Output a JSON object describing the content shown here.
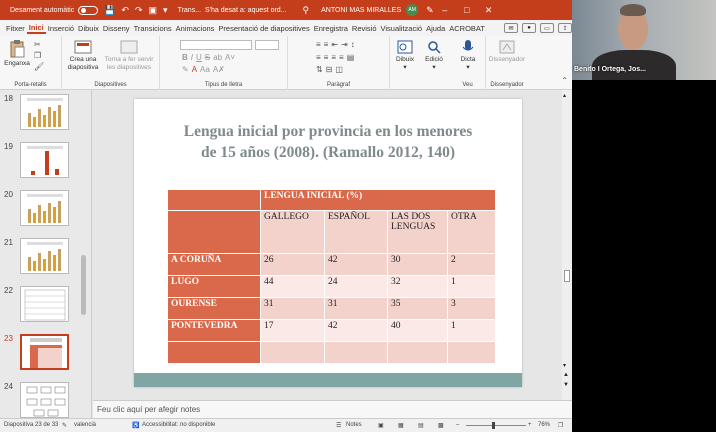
{
  "titlebar": {
    "autosave_label": "Desament automàtic",
    "doc_name": "Trans...",
    "save_status": "S'ha desat a: aquest ord...",
    "user_name": "ANTONI MAS MIRALLES",
    "user_initials": "AM"
  },
  "tabs": [
    "Fitxer",
    "Inici",
    "Inserció",
    "Dibuix",
    "Disseny",
    "Transicions",
    "Animacions",
    "Presentació de diapositives",
    "Enregistra",
    "Revisió",
    "Visualització",
    "Ajuda",
    "ACROBAT"
  ],
  "active_tab": "Inici",
  "ribbon": {
    "clipboard": {
      "paste_label": "Enganxa",
      "group_label": "Porta-retalls"
    },
    "slides": {
      "new_slide_label": "Crea una diapositiva",
      "reset_label": "Torna a fer servir les diapositives",
      "group_label": "Diapositives"
    },
    "font": {
      "group_label": "Tipus de lletra"
    },
    "paragraph": {
      "group_label": "Paràgraf"
    },
    "drawing": {
      "label": "Dibuix"
    },
    "editing": {
      "label": "Edició"
    },
    "dictate": {
      "label": "Dicta"
    },
    "designer": {
      "label": "Dissenyador"
    },
    "voice_group_label": "Veu",
    "designer_group_label": "Dissenyador"
  },
  "thumbnails": [
    {
      "num": "18",
      "kind": "bars"
    },
    {
      "num": "19",
      "kind": "bar-single"
    },
    {
      "num": "20",
      "kind": "bars"
    },
    {
      "num": "21",
      "kind": "bars"
    },
    {
      "num": "22",
      "kind": "table"
    },
    {
      "num": "23",
      "kind": "table-red",
      "selected": true
    },
    {
      "num": "24",
      "kind": "diagram"
    }
  ],
  "slide": {
    "title_line1": "Lengua inicial por provincia en los menores",
    "title_line2": "de 15 años (2008). (Ramallo 2012, 140)",
    "table": {
      "header": "LENGUA INICIAL (%)",
      "columns": [
        "GALLEGO",
        "ESPAÑOL",
        "LAS DOS LENGUAS",
        "OTRA"
      ],
      "rows": [
        {
          "province": "A CORUÑA",
          "values": [
            "26",
            "42",
            "30",
            "2"
          ]
        },
        {
          "province": "LUGO",
          "values": [
            "44",
            "24",
            "32",
            "1"
          ]
        },
        {
          "province": "OURENSE",
          "values": [
            "31",
            "31",
            "35",
            "3"
          ]
        },
        {
          "province": "PONTEVEDRA",
          "values": [
            "17",
            "42",
            "40",
            "1"
          ]
        }
      ]
    }
  },
  "notes_placeholder": "Feu clic aquí per afegir notes",
  "statusbar": {
    "slide_info": "Diapositiva 23 de 33",
    "language": "valencià",
    "accessibility": "Accessibilitat: no disponible",
    "notes_label": "Notes",
    "zoom": "76%"
  },
  "webcam": {
    "name": "Benito I Ortega, Jos..."
  },
  "colors": {
    "accent": "#c43e1c",
    "table_header": "#d9694a",
    "table_light": "#f3d2cc",
    "footer_band": "#7fa5a5"
  }
}
